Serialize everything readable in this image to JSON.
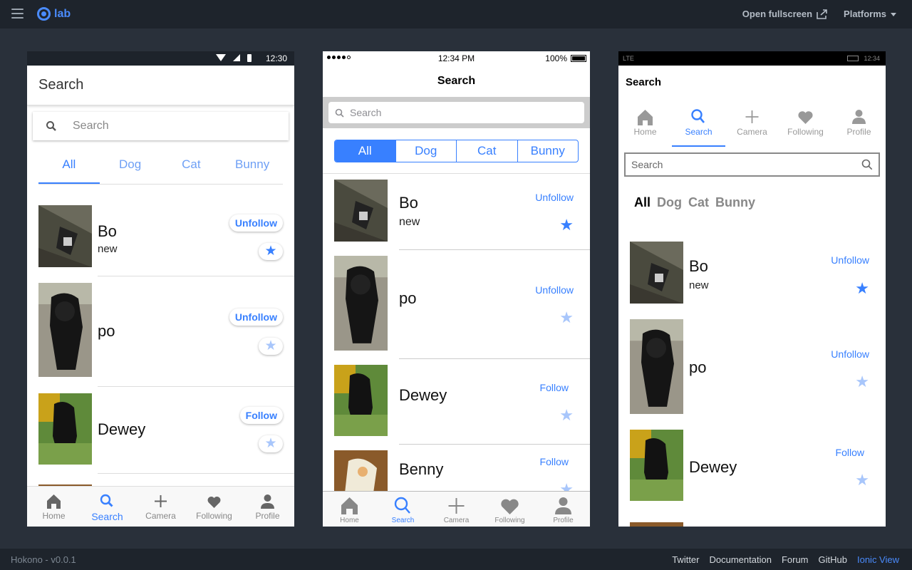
{
  "topbar": {
    "logo_text": "lab",
    "open_fullscreen": "Open fullscreen",
    "platforms": "Platforms"
  },
  "footer": {
    "version": "Hokono - v0.0.1",
    "links": [
      "Twitter",
      "Documentation",
      "Forum",
      "GitHub",
      "Ionic View"
    ]
  },
  "android": {
    "status_time": "12:30",
    "title": "Search",
    "search_placeholder": "Search",
    "segments": [
      "All",
      "Dog",
      "Cat",
      "Bunny"
    ],
    "tabs": [
      "Home",
      "Search",
      "Camera",
      "Following",
      "Profile"
    ]
  },
  "ios": {
    "status_time": "12:34 PM",
    "battery": "100%",
    "title": "Search",
    "search_placeholder": "Search",
    "segments": [
      "All",
      "Dog",
      "Cat",
      "Bunny"
    ],
    "tabs": [
      "Home",
      "Search",
      "Camera",
      "Following",
      "Profile"
    ]
  },
  "windows": {
    "status_network": "LTE",
    "status_time": "12:34",
    "title": "Search",
    "search_placeholder": "Search",
    "segments": [
      "All",
      "Dog",
      "Cat",
      "Bunny"
    ],
    "tabs": [
      "Home",
      "Search",
      "Camera",
      "Following",
      "Profile"
    ]
  },
  "pets": [
    {
      "name": "Bo",
      "sub": "new",
      "action": "Unfollow",
      "favorite": true
    },
    {
      "name": "po",
      "sub": "",
      "action": "Unfollow",
      "favorite": false
    },
    {
      "name": "Dewey",
      "sub": "",
      "action": "Follow",
      "favorite": false
    },
    {
      "name": "Benny",
      "sub": "",
      "action": "Follow",
      "favorite": false
    }
  ],
  "colors": {
    "accent": "#3880ff",
    "chrome": "#1e242c",
    "background": "#29303a"
  }
}
